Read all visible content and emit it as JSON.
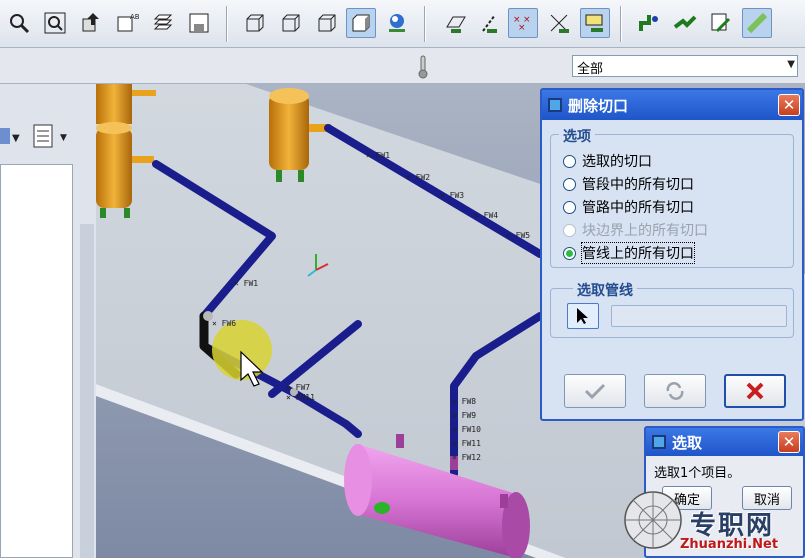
{
  "toolbar": {
    "icons": [
      "zoom-icon",
      "zoom-window-icon",
      "pan-icon",
      "named-view-icon",
      "layers-icon",
      "save-view-icon",
      "wireframe-icon",
      "hidden-line-icon",
      "no-hidden-icon",
      "shaded-icon",
      "spin-center-icon",
      "plane-icon",
      "axis-icon",
      "points-icon",
      "csys-icon",
      "annotation-icon",
      "pipe-flow-icon",
      "pipe-route-icon",
      "pipe-edit-icon",
      "pipe-straight-icon"
    ]
  },
  "filter": {
    "value": "全部"
  },
  "viewport": {
    "tags": [
      "FW1",
      "FW2",
      "FW3",
      "FW4",
      "FW5",
      "FW1",
      "FW6",
      "FW7",
      "FN11",
      "FW8",
      "FW9",
      "FW10",
      "FW11",
      "FW12"
    ]
  },
  "dialog_delete": {
    "title": "删除切口",
    "close": "✕",
    "group_options": "选项",
    "options": [
      {
        "label": "选取的切口",
        "checked": false,
        "enabled": true
      },
      {
        "label": "管段中的所有切口",
        "checked": false,
        "enabled": true
      },
      {
        "label": "管路中的所有切口",
        "checked": false,
        "enabled": true
      },
      {
        "label": "块边界上的所有切口",
        "checked": false,
        "enabled": false
      },
      {
        "label": "管线上的所有切口",
        "checked": true,
        "enabled": true
      }
    ],
    "group_pick": "选取管线",
    "pick_value": ""
  },
  "dialog_select": {
    "title": "选取",
    "close": "✕",
    "message": "选取1个项目。",
    "ok": "确定",
    "cancel": "取消"
  },
  "watermark": {
    "text": "专职网",
    "url": "Zhuanzhi.Net"
  },
  "colors": {
    "pipe": "#1a1d8c",
    "tank": "#e8a21c",
    "vessel": "#d774d4",
    "floor": "#cfd5dc",
    "accent": "#2a5bc9"
  }
}
